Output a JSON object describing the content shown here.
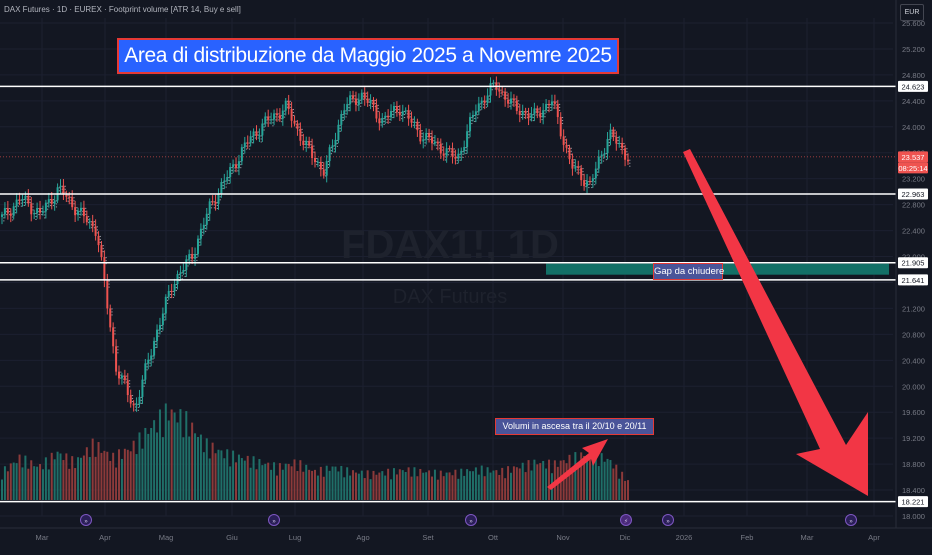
{
  "header": {
    "title": "DAX Futures · 1D · EUREX · Footprint volume [ATR 14, Buy e sell]",
    "currency": "EUR"
  },
  "watermark": {
    "symbol": "FDAX1!, 1D",
    "name": "DAX Futures"
  },
  "annotations": {
    "title": "Area di distribuzione da Maggio 2025 a Novemre 2025",
    "gap": "Gap da chiudere",
    "volume_note": "Volumi in ascesa tra il 20/10 e 20/11"
  },
  "colors": {
    "background": "#131722",
    "up": "#26a69a",
    "down": "#ef5350",
    "volume_up": "#1f6f68",
    "volume_down": "#8c3a3a",
    "level_line": "#ffffff",
    "gap_zone": "#137067",
    "arrow": "#f23645",
    "annotation_fill": "#2962ff",
    "annotation_border": "#e53935"
  },
  "chart_data": {
    "type": "candlestick",
    "y_axis": {
      "ticks": [
        "25.600",
        "25.200",
        "24.800",
        "24.400",
        "24.000",
        "23.600",
        "23.200",
        "22.800",
        "22.400",
        "22.000",
        "21.600",
        "21.200",
        "20.800",
        "20.400",
        "20.000",
        "19.600",
        "19.200",
        "18.800",
        "18.400",
        "18.000"
      ],
      "ylim": [
        17950,
        25700
      ]
    },
    "x_axis": {
      "ticks": [
        "Mar",
        "Apr",
        "Mag",
        "Giu",
        "Lug",
        "Ago",
        "Set",
        "Ott",
        "Nov",
        "Dic",
        "2026",
        "Feb",
        "Mar",
        "Apr"
      ]
    },
    "price_labels": [
      {
        "text": "24.623",
        "value": 24623
      },
      {
        "text": "23.537",
        "value": 23537
      },
      {
        "text": "08:25:14",
        "value": 23537
      },
      {
        "text": "22.963",
        "value": 22963
      },
      {
        "text": "21.905",
        "value": 21905
      },
      {
        "text": "21.641",
        "value": 21641
      },
      {
        "text": "18.221",
        "value": 18221
      }
    ],
    "horizontal_levels": [
      24623,
      22963,
      21905,
      21641,
      18221
    ],
    "current_price": 23537,
    "gap_zone": {
      "from": "Nov",
      "low": 21720,
      "high": 21890
    },
    "price_path": [
      {
        "date": "Feb",
        "close": 22600
      },
      {
        "date": "Mar",
        "close": 22900
      },
      {
        "date": "Mar",
        "close": 22650
      },
      {
        "date": "Mar",
        "close": 23050
      },
      {
        "date": "Mar",
        "close": 22700
      },
      {
        "date": "Mar",
        "close": 22400
      },
      {
        "date": "Apr",
        "close": 20300
      },
      {
        "date": "Apr",
        "close": 19650
      },
      {
        "date": "Apr",
        "close": 20700
      },
      {
        "date": "Apr",
        "close": 21600
      },
      {
        "date": "Apr",
        "close": 22000
      },
      {
        "date": "Mag",
        "close": 22800
      },
      {
        "date": "Mag",
        "close": 23300
      },
      {
        "date": "Mag",
        "close": 23800
      },
      {
        "date": "Mag",
        "close": 24100
      },
      {
        "date": "Giu",
        "close": 24300
      },
      {
        "date": "Giu",
        "close": 23700
      },
      {
        "date": "Giu",
        "close": 23300
      },
      {
        "date": "Lug",
        "close": 24300
      },
      {
        "date": "Lug",
        "close": 24500
      },
      {
        "date": "Ago",
        "close": 24100
      },
      {
        "date": "Ago",
        "close": 24300
      },
      {
        "date": "Ago",
        "close": 23900
      },
      {
        "date": "Set",
        "close": 23700
      },
      {
        "date": "Set",
        "close": 23500
      },
      {
        "date": "Ott",
        "close": 24300
      },
      {
        "date": "Ott",
        "close": 24650
      },
      {
        "date": "Ott",
        "close": 24300
      },
      {
        "date": "Nov",
        "close": 24150
      },
      {
        "date": "Nov",
        "close": 24400
      },
      {
        "date": "Nov",
        "close": 23400
      },
      {
        "date": "Nov",
        "close": 23100
      },
      {
        "date": "Dic",
        "close": 23900
      },
      {
        "date": "Dic",
        "close": 23537
      }
    ],
    "volume_profile": [
      0.3,
      0.45,
      0.35,
      0.5,
      0.4,
      0.6,
      0.45,
      0.55,
      0.75,
      0.95,
      0.85,
      0.6,
      0.5,
      0.45,
      0.4,
      0.35,
      0.4,
      0.3,
      0.35,
      0.3,
      0.28,
      0.3,
      0.32,
      0.3,
      0.28,
      0.3,
      0.33,
      0.3,
      0.35,
      0.4,
      0.38,
      0.45,
      0.5,
      0.42,
      0.2
    ],
    "event_markers": 6
  }
}
